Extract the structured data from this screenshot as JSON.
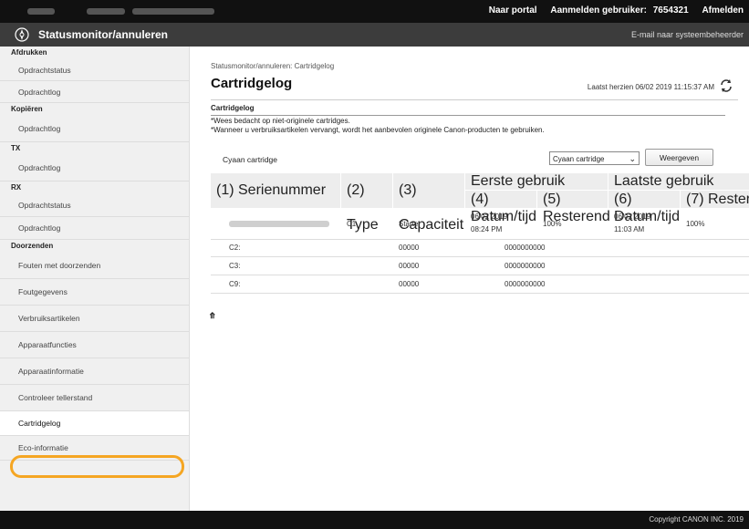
{
  "topbar": {
    "portal_label": "Naar portal",
    "login_label": "Aanmelden gebruiker:",
    "user_id": "7654321",
    "logout_label": "Afmelden"
  },
  "header": {
    "title": "Statusmonitor/annuleren",
    "email_link": "E-mail naar systeembeheerder"
  },
  "sidebar": {
    "sections": [
      {
        "heading": "Afdrukken",
        "items": [
          "Opdrachtstatus",
          "Opdrachtlog"
        ]
      },
      {
        "heading": "Kopiëren",
        "items": [
          "Opdrachtlog"
        ]
      },
      {
        "heading": "TX",
        "items": [
          "Opdrachtlog"
        ]
      },
      {
        "heading": "RX",
        "items": [
          "Opdrachtstatus",
          "Opdrachtlog"
        ]
      },
      {
        "heading": "Doorzenden",
        "items": [
          "Fouten met doorzenden",
          "Foutgegevens",
          "Verbruiksartikelen",
          "Apparaatfuncties",
          "Apparaatinformatie",
          "Controleer tellerstand",
          "Cartridgelog",
          "Eco-informatie"
        ]
      }
    ],
    "active_item": "Cartridgelog"
  },
  "main": {
    "breadcrumb": "Statusmonitor/annuleren: Cartridgelog",
    "title": "Cartridgelog",
    "last_updated": "Laatst herzien 06/02 2019 11:15:37 AM",
    "section_title": "Cartridgelog",
    "note1": "*Wees bedacht op niet-originele cartridges.",
    "note2": "*Wanneer u verbruiksartikelen vervangt, wordt het aanbevolen originele Canon-producten te gebruiken.",
    "cartridge_label": "Cyaan cartridge",
    "select_value": "Cyaan cartridge",
    "show_button": "Weergeven"
  },
  "table": {
    "headers": {
      "serial": "(1) Serienummer",
      "type": "(2) Type",
      "capacity": "(3) Capaciteit",
      "first_use": "Eerste gebruik",
      "first_datetime": "(4) Datum/tijd",
      "first_remaining": "(5) Resterend",
      "last_use": "Laatste gebruik",
      "last_datetime": "(6) Datum/tijd",
      "last_remaining": "(7) Resterend"
    },
    "row1": {
      "type": "C1",
      "capacity": "Starter",
      "first_date": "06/02 2019",
      "first_time": "08:24 PM",
      "first_remaining": "100%",
      "last_date": "06/02 2019",
      "last_time": "11:03 AM",
      "last_remaining": "100%"
    },
    "rows": [
      {
        "label": "C2:",
        "capacity": "00000",
        "value": "0000000000"
      },
      {
        "label": "C3:",
        "capacity": "00000",
        "value": "0000000000"
      },
      {
        "label": "C9:",
        "capacity": "00000",
        "value": "0000000000"
      }
    ]
  },
  "footer": {
    "copyright": "Copyright CANON INC. 2019"
  }
}
